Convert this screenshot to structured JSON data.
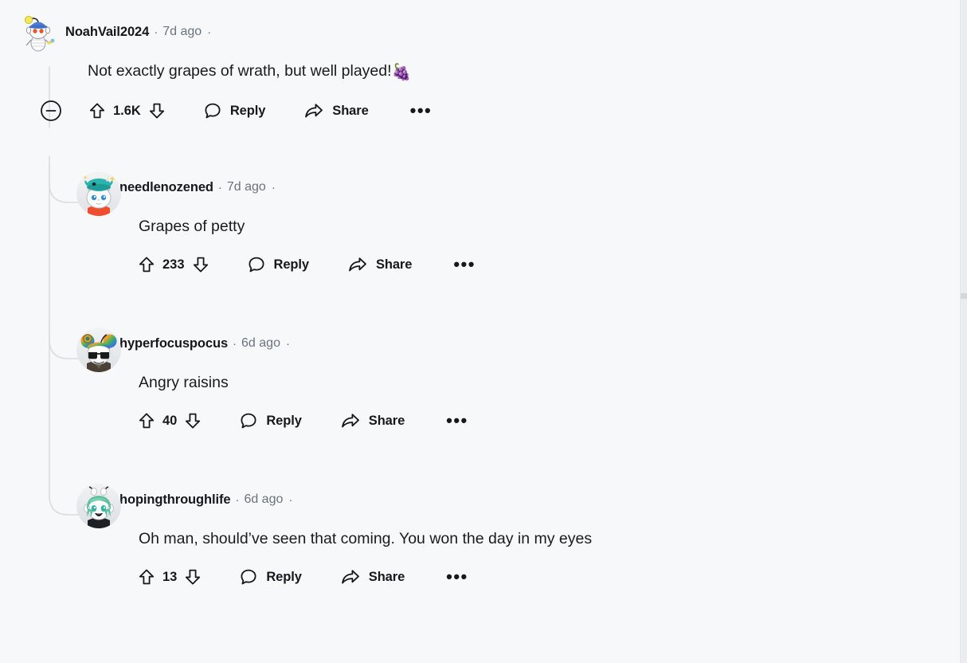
{
  "theme": {
    "background": "#f7f8fa",
    "text_primary": "#16181c",
    "text_meta": "#6a737c",
    "thread_line": "#d9dde1",
    "edge_strip": "#eaecef"
  },
  "labels": {
    "reply": "Reply",
    "share": "Share",
    "overflow": "•••",
    "separator": "·"
  },
  "icons": {
    "collapse": "collapse-minus-icon",
    "upvote": "upvote-arrow-icon",
    "downvote": "downvote-arrow-icon",
    "reply": "comment-bubble-icon",
    "share": "share-arrow-icon",
    "overflow": "more-options-icon"
  },
  "comments": [
    {
      "id": "c1",
      "depth": 0,
      "username": "NoahVail2024",
      "age": "7d ago",
      "body": "Not exactly grapes of wrath, but well played!",
      "emoji": "🍇",
      "score": "1.6K",
      "avatar": "snoo-blue-hat-antenna",
      "collapsible": true
    },
    {
      "id": "c2",
      "depth": 1,
      "username": "needlenozened",
      "age": "7d ago",
      "body": "Grapes of petty",
      "emoji": "",
      "score": "233",
      "avatar": "snoo-white-cat-narwhal-hat",
      "collapsible": false
    },
    {
      "id": "c3",
      "depth": 1,
      "username": "hyperfocuspocus",
      "age": "6d ago",
      "body": "Angry raisins",
      "emoji": "",
      "score": "40",
      "avatar": "snoo-rainbow-ears-sunglasses",
      "collapsible": false
    },
    {
      "id": "c4",
      "depth": 1,
      "username": "hopingthroughlife",
      "age": "6d ago",
      "body": "Oh man, should’ve seen that coming. You won the day in my eyes",
      "emoji": "",
      "score": "13",
      "avatar": "snoo-green-hair-anime",
      "collapsible": false
    }
  ]
}
